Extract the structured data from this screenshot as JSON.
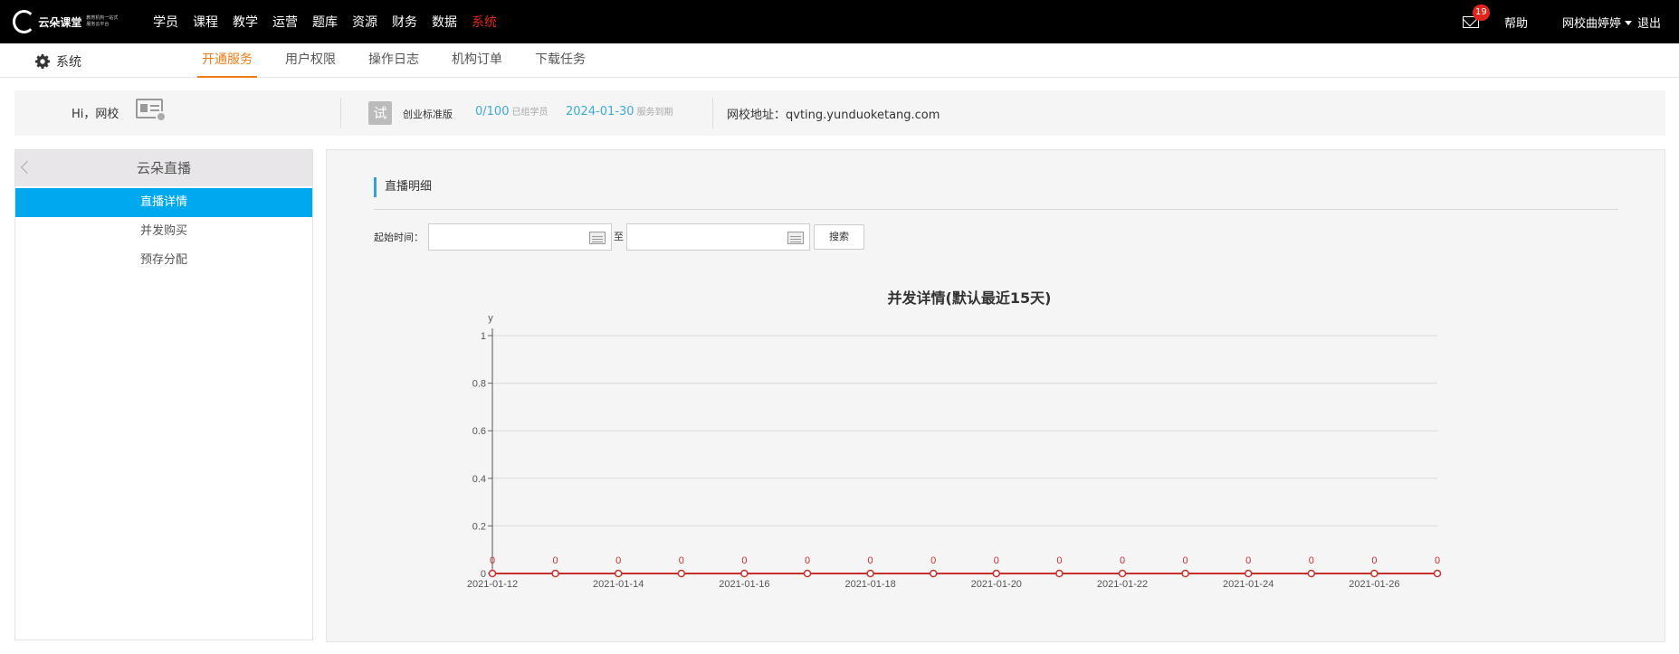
{
  "logo": {
    "text": "云朵课堂",
    "sub": "教育机构一站式服务云平台"
  },
  "topnav": [
    "学员",
    "课程",
    "教学",
    "运营",
    "题库",
    "资源",
    "财务",
    "数据",
    "系统"
  ],
  "topnav_active": "系统",
  "top_right": {
    "mail_count": "19",
    "help": "帮助",
    "user": "网校曲婷婷",
    "logout": "退出"
  },
  "subnav": {
    "section": "系统",
    "tabs": [
      "开通服务",
      "用户权限",
      "操作日志",
      "机构订单",
      "下载任务"
    ],
    "active": "开通服务"
  },
  "info": {
    "greeting": "Hi，网校",
    "trial_badge": "试",
    "plan": "创业标准版",
    "quota_value": "0/100",
    "quota_label": "已组学员",
    "expire_date": "2024-01-30",
    "expire_label": "服务到期",
    "school_label": "网校地址：",
    "school_url": "qvting.yunduoketang.com"
  },
  "sidebar": {
    "title": "云朵直播",
    "items": [
      "直播详情",
      "并发购买",
      "预存分配"
    ],
    "active": "直播详情"
  },
  "main": {
    "title": "直播明细",
    "filter_label": "起始时间：",
    "start_value": "",
    "end_value": "",
    "to_label": "至",
    "search_label": "搜索"
  },
  "chart_data": {
    "type": "line",
    "title": "并发详情(默认最近15天)",
    "ylabel": "y",
    "xlabel": "",
    "ylim": [
      0,
      1
    ],
    "yticks": [
      0,
      0.2,
      0.4,
      0.6,
      0.8,
      1
    ],
    "x": [
      "2021-01-12",
      "2021-01-13",
      "2021-01-14",
      "2021-01-15",
      "2021-01-16",
      "2021-01-17",
      "2021-01-18",
      "2021-01-19",
      "2021-01-20",
      "2021-01-21",
      "2021-01-22",
      "2021-01-23",
      "2021-01-24",
      "2021-01-25",
      "2021-01-26",
      "2021-01-27"
    ],
    "xtick_labels": [
      "2021-01-12",
      "2021-01-14",
      "2021-01-16",
      "2021-01-18",
      "2021-01-20",
      "2021-01-22",
      "2021-01-24",
      "2021-01-26"
    ],
    "series": [
      {
        "values": [
          0,
          0,
          0,
          0,
          0,
          0,
          0,
          0,
          0,
          0,
          0,
          0,
          0,
          0,
          0,
          0
        ]
      }
    ],
    "grid": true,
    "line_color": "#c9302c"
  }
}
